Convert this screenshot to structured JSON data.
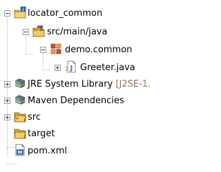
{
  "tree": {
    "project": {
      "label": "locator_common"
    },
    "items": [
      {
        "label": "src/main/java"
      },
      {
        "label": "demo.common"
      },
      {
        "label": "Greeter.java"
      },
      {
        "label": "JRE System Library",
        "suffix": "[J2SE-1."
      },
      {
        "label": "Maven Dependencies"
      },
      {
        "label": "src"
      },
      {
        "label": "target"
      },
      {
        "label": "pom.xml"
      }
    ]
  },
  "icons": {
    "project": "java-project-icon",
    "source_folder": "package-folder-icon",
    "package": "package-icon",
    "java_file": "java-file-icon",
    "library": "library-icon",
    "folder": "folder-icon",
    "xml_file": "maven-pom-icon"
  },
  "colors": {
    "background": "#ffffff",
    "connector": "#b5b5b5",
    "text": "#000000",
    "suffix": "#8a7a52"
  }
}
